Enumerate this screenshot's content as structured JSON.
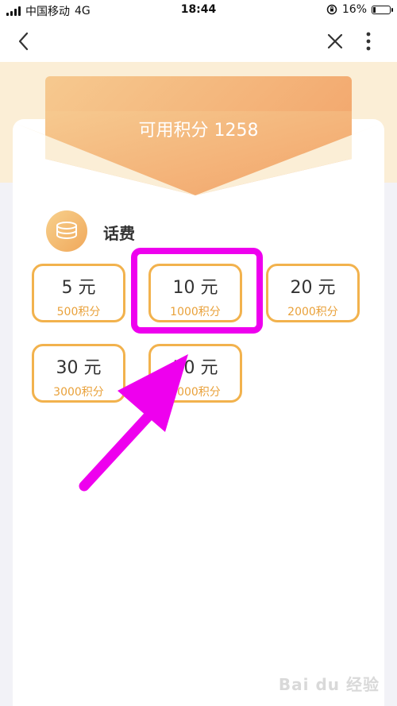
{
  "status_bar": {
    "carrier": "中国移动",
    "network": "4G",
    "time": "18:44",
    "battery": "16%",
    "battery_level": 0.16
  },
  "nav": {
    "back_icon": "chevron-left-icon",
    "close_icon": "close-icon",
    "more_icon": "more-vertical-icon"
  },
  "points": {
    "label": "可用积分 1258"
  },
  "section": {
    "title": "话费",
    "icon": "coins-icon"
  },
  "options": [
    {
      "amount": "5 元",
      "cost": "500积分"
    },
    {
      "amount": "10 元",
      "cost": "1000积分"
    },
    {
      "amount": "20 元",
      "cost": "2000积分"
    },
    {
      "amount": "30 元",
      "cost": "3000积分"
    },
    {
      "amount": "50 元",
      "cost": "5000积分"
    }
  ],
  "colors": {
    "accent": "#f2b24d",
    "cost_text": "#e9a13a",
    "annotation": "#ee00ee",
    "banner": "#f2a46a"
  },
  "watermark": "Bai du 经验"
}
